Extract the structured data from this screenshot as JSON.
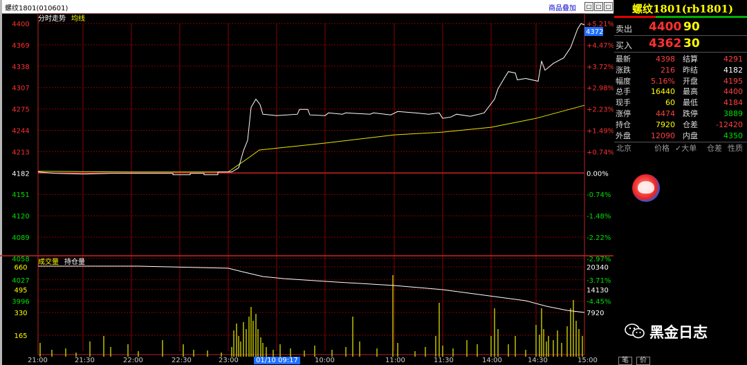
{
  "title_bar": {
    "text": "螺纹1801(010601)",
    "overlay_link": "商品叠加",
    "btn_1": "□",
    "btn_2": "□",
    "btn_3": "□"
  },
  "main_chart": {
    "legend": {
      "line1": "分时走势",
      "line2": "均线"
    },
    "y_left": [
      "4400",
      "4369",
      "4338",
      "4307",
      "4275",
      "4244",
      "4213",
      "4182",
      "4151",
      "4120",
      "4089",
      "4058",
      "4027",
      "3996"
    ],
    "y_right": [
      "+5.21%",
      "+4.47%",
      "+3.72%",
      "+2.98%",
      "+2.23%",
      "+1.49%",
      "+0.74%",
      "0.00%",
      "-0.74%",
      "-1.48%",
      "-2.22%",
      "-2.97%",
      "-3.71%",
      "-4.45%"
    ],
    "cursor_price": "4372"
  },
  "volume_chart": {
    "legend": {
      "vol": "成交量",
      "oi": "持仓量"
    },
    "y_left": [
      "660",
      "495",
      "330",
      "165"
    ],
    "y_right": [
      "20340",
      "14130",
      "7920"
    ]
  },
  "time_axis": [
    "21:00",
    "21:30",
    "22:00",
    "22:30",
    "23:00",
    "01/10 09:17",
    "10:00",
    "11:00",
    "11:30",
    "14:00",
    "14:30",
    "15:00"
  ],
  "colors": {
    "price_line": "#ffffff",
    "avg_line": "#ffff00",
    "grid": "#8b0000",
    "up": "#ff3030",
    "down": "#00e000"
  },
  "chart_data": {
    "type": "line",
    "x": [
      "21:00",
      "21:30",
      "22:00",
      "22:30",
      "23:00",
      "09:00",
      "10:00",
      "11:00",
      "11:30",
      "14:00",
      "14:30",
      "15:00"
    ],
    "series": [
      {
        "name": "分时走势",
        "values": [
          4184,
          4182,
          4183,
          4180,
          4184,
          4265,
          4258,
          4257,
          4258,
          4259,
          4289,
          4400
        ]
      },
      {
        "name": "均线",
        "values": [
          4185,
          4184,
          4184,
          4184,
          4184,
          4214,
          4226,
          4238,
          4242,
          4249,
          4262,
          4281
        ]
      }
    ],
    "ylim": [
      3996,
      4400
    ],
    "baseline": 4182,
    "volume": {
      "ylim": [
        0,
        660
      ],
      "open_interest_range": [
        7920,
        20340
      ]
    }
  },
  "quote": {
    "name": "螺纹1801(rb1801)",
    "sell": {
      "label": "卖出",
      "price": "4400",
      "vol": "90"
    },
    "buy": {
      "label": "买入",
      "price": "4362",
      "vol": "30"
    },
    "rows": [
      {
        "l1": "最新",
        "v1": "4398",
        "l2": "结算",
        "v2": "4291"
      },
      {
        "l1": "涨跌",
        "v1": "216",
        "l2": "昨结",
        "v2": "4182"
      },
      {
        "l1": "幅度",
        "v1": "5.16%",
        "l2": "开盘",
        "v2": "4195"
      },
      {
        "l1": "总手",
        "v1": "16440",
        "l2": "最高",
        "v2": "4400"
      },
      {
        "l1": "现手",
        "v1": "60",
        "l2": "最低",
        "v2": "4184"
      },
      {
        "l1": "涨停",
        "v1": "4474",
        "l2": "跌停",
        "v2": "3889"
      },
      {
        "l1": "持仓",
        "v1": "7920",
        "l2": "仓差",
        "v2": "-12420"
      },
      {
        "l1": "外盘",
        "v1": "12090",
        "l2": "内盘",
        "v2": "4350"
      }
    ],
    "tick_header": {
      "c1": "北京",
      "c2": "价格",
      "c3": "✓大单",
      "c4": "仓差",
      "c5": "性质"
    }
  },
  "watermark": "黑金日志",
  "bottom_tabs": {
    "t1": "笔",
    "t2": "价"
  }
}
